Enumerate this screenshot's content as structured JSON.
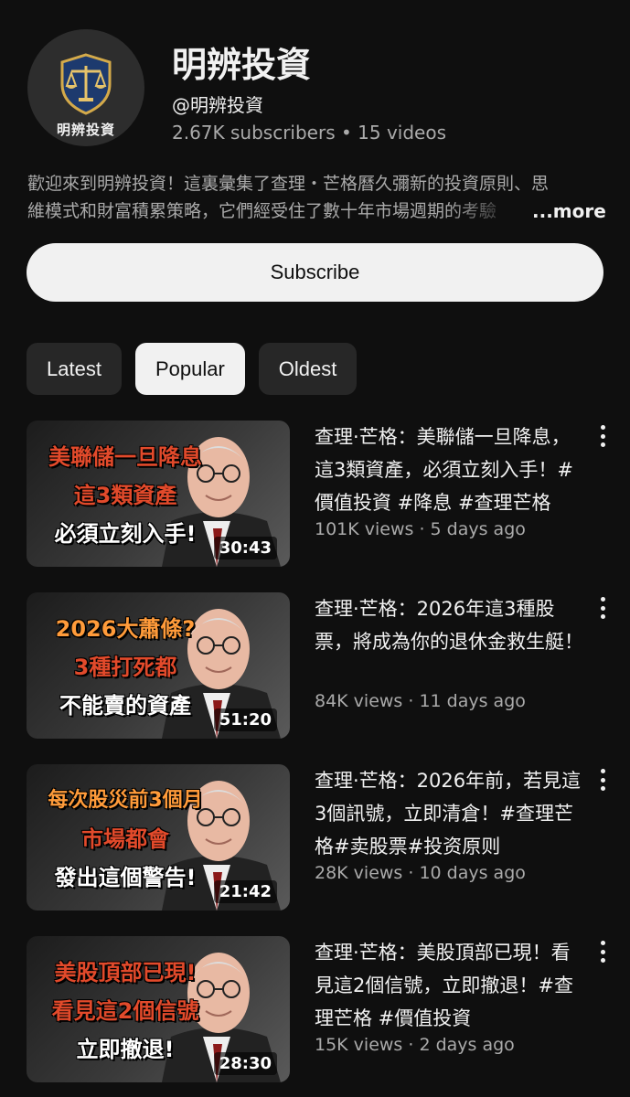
{
  "channel": {
    "avatar_label": "明辨投資",
    "name": "明辨投資",
    "handle": "@明辨投資",
    "subscribers": "2.67K subscribers",
    "separator": " • ",
    "videos_count": "15 videos",
    "description_line1": "歡迎來到明辨投資！這裏彙集了查理・芒格曆久彌新的投資原則、思",
    "description_line2": "維模式和財富積累策略，它們經受住了數十年市場週期的考驗",
    "more_label": "...more",
    "subscribe_label": "Subscribe"
  },
  "chips": [
    {
      "label": "Latest",
      "active": false
    },
    {
      "label": "Popular",
      "active": true
    },
    {
      "label": "Oldest",
      "active": false
    }
  ],
  "videos": [
    {
      "thumb_lines": [
        "美聯儲一旦降息",
        "這3類資產",
        "必須立刻入手!"
      ],
      "duration": "30:43",
      "title": "查理·芒格：美聯儲一旦降息，這3類資產，必須立刻入手！#價值投資 #降息 #查理芒格",
      "meta": "101K views · 5 days ago"
    },
    {
      "thumb_lines": [
        "2026大蕭條?",
        "3種打死都",
        "不能賣的資產"
      ],
      "duration": "51:20",
      "title": "查理·芒格：2026年這3種股票，將成為你的退休金救生艇！",
      "meta": "84K views · 11 days ago"
    },
    {
      "thumb_lines": [
        "每次股災前3個月",
        "市場都會",
        "發出這個警告!"
      ],
      "duration": "21:42",
      "title": "查理·芒格：2026年前，若見這3個訊號，立即清倉！#查理芒格#卖股票#投资原则",
      "meta": "28K views · 10 days ago"
    },
    {
      "thumb_lines": [
        "美股頂部已現!",
        "看見這2個信號",
        "立即撤退!"
      ],
      "duration": "28:30",
      "title": "查理·芒格：美股頂部已現！看見這2個信號，立即撤退！#查理芒格 #價值投資",
      "meta": "15K views · 2 days ago"
    }
  ],
  "colors": {
    "background": "#0f0f0f",
    "text_primary": "#f1f1f1",
    "text_secondary": "#aaaaaa",
    "chip_bg": "#272727",
    "thumb_red": "#e24a2b",
    "thumb_orange": "#ff9b3a"
  },
  "icons": {
    "avatar_emblem": "scales-of-justice-shield-icon",
    "video_menu": "more-vert-icon"
  }
}
